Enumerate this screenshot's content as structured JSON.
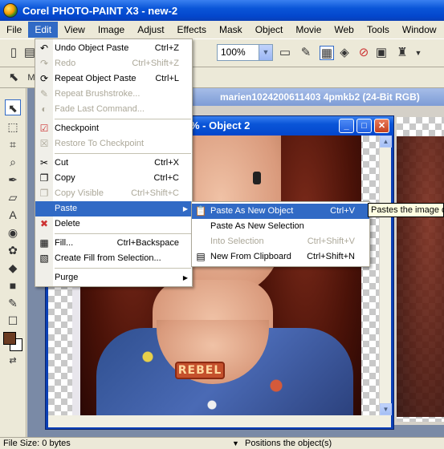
{
  "window": {
    "title": "Corel PHOTO-PAINT X3 - new-2"
  },
  "menubar": [
    "File",
    "Edit",
    "View",
    "Image",
    "Adjust",
    "Effects",
    "Mask",
    "Object",
    "Movie",
    "Web",
    "Tools",
    "Window"
  ],
  "toolbar": {
    "zoom": "100%"
  },
  "background_doc": {
    "title": "marien1024200611403 4pmkb2 (24-Bit RGB)"
  },
  "document": {
    "title": "% - Object 2",
    "necklace_text": "REBEL"
  },
  "edit_menu": {
    "items": [
      {
        "label": "Undo Object Paste",
        "shortcut": "Ctrl+Z",
        "icon": "undo-icon",
        "disabled": false
      },
      {
        "label": "Redo",
        "shortcut": "Ctrl+Shift+Z",
        "icon": "redo-icon",
        "disabled": true
      },
      {
        "label": "Repeat Object Paste",
        "shortcut": "Ctrl+L",
        "icon": "repeat-icon",
        "disabled": false
      },
      {
        "label": "Repeat Brushstroke...",
        "shortcut": "",
        "icon": "brushstroke-icon",
        "disabled": true
      },
      {
        "label": "Fade Last Command...",
        "shortcut": "",
        "icon": "fade-icon",
        "disabled": true
      },
      {
        "label": "Checkpoint",
        "shortcut": "",
        "icon": "checkpoint-icon",
        "disabled": false
      },
      {
        "label": "Restore To Checkpoint",
        "shortcut": "",
        "icon": "restore-icon",
        "disabled": true
      },
      {
        "label": "Cut",
        "shortcut": "Ctrl+X",
        "icon": "cut-icon",
        "disabled": false
      },
      {
        "label": "Copy",
        "shortcut": "Ctrl+C",
        "icon": "copy-icon",
        "disabled": false
      },
      {
        "label": "Copy Visible",
        "shortcut": "Ctrl+Shift+C",
        "icon": "copy-visible-icon",
        "disabled": true
      },
      {
        "label": "Paste",
        "shortcut": "",
        "icon": "",
        "disabled": false
      },
      {
        "label": "Delete",
        "shortcut": "",
        "icon": "delete-icon",
        "disabled": false
      },
      {
        "label": "Fill...",
        "shortcut": "Ctrl+Backspace",
        "icon": "fill-icon",
        "disabled": false
      },
      {
        "label": "Create Fill from Selection...",
        "shortcut": "",
        "icon": "create-fill-icon",
        "disabled": false
      },
      {
        "label": "Purge",
        "shortcut": "",
        "icon": "",
        "disabled": false
      }
    ]
  },
  "paste_submenu": {
    "items": [
      {
        "label": "Paste As New Object",
        "shortcut": "Ctrl+V",
        "icon": "paste-object-icon",
        "disabled": false
      },
      {
        "label": "Paste As New Selection",
        "shortcut": "",
        "icon": "",
        "disabled": false
      },
      {
        "label": "Into Selection",
        "shortcut": "Ctrl+Shift+V",
        "icon": "",
        "disabled": true
      },
      {
        "label": "New From Clipboard",
        "shortcut": "Ctrl+Shift+N",
        "icon": "new-clipboard-icon",
        "disabled": false
      }
    ]
  },
  "tooltip": "Pastes the image da",
  "statusbar": {
    "file_size": "File Size: 0 bytes",
    "message": "Positions the object(s)"
  },
  "colors": {
    "titlebar": "#0a55d8",
    "highlight": "#316ac5",
    "fg_swatch": "#6b3b22"
  }
}
